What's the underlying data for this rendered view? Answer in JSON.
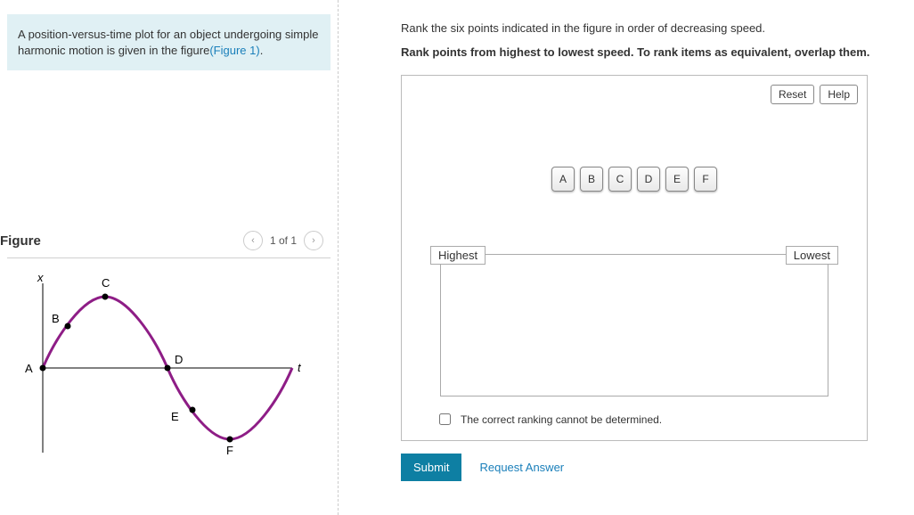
{
  "left": {
    "prompt_text_1": "A position-versus-time plot for an object undergoing simple harmonic motion is given in the figure",
    "prompt_link": "(Figure 1)",
    "prompt_text_2": ".",
    "figure_heading": "Figure",
    "pager_label": "1 of 1",
    "axes": {
      "x": "t",
      "y": "x"
    },
    "points": [
      "A",
      "B",
      "C",
      "D",
      "E",
      "F"
    ]
  },
  "right": {
    "question_line1": "Rank the six points indicated in the figure in order of decreasing speed.",
    "question_line2": "Rank points from highest to lowest speed. To rank items as equivalent, overlap them.",
    "reset_label": "Reset",
    "help_label": "Help",
    "tiles": [
      "A",
      "B",
      "C",
      "D",
      "E",
      "F"
    ],
    "dropzone": {
      "left_label": "Highest",
      "right_label": "Lowest"
    },
    "cannot_determine_label": "The correct ranking cannot be determined.",
    "submit_label": "Submit",
    "request_label": "Request Answer"
  },
  "chart_data": {
    "type": "line",
    "title": "",
    "xlabel": "t",
    "ylabel": "x",
    "xlim": [
      0,
      10
    ],
    "ylim": [
      -1,
      1
    ],
    "series": [
      {
        "name": "position",
        "x": [
          0,
          0.5,
          1,
          1.5,
          2,
          2.5,
          3,
          3.5,
          4,
          4.5,
          5,
          5.5,
          6,
          6.5,
          7,
          7.5,
          8,
          8.5,
          9,
          9.5,
          10
        ],
        "y": [
          0,
          0.31,
          0.59,
          0.81,
          0.95,
          1.0,
          0.95,
          0.81,
          0.59,
          0.31,
          0,
          -0.31,
          -0.59,
          -0.81,
          -0.95,
          -1.0,
          -0.95,
          -0.81,
          -0.59,
          -0.31,
          0
        ]
      }
    ],
    "annotations": [
      {
        "label": "A",
        "x": 0,
        "y": 0
      },
      {
        "label": "B",
        "x": 1,
        "y": 0.59
      },
      {
        "label": "C",
        "x": 2.5,
        "y": 1.0
      },
      {
        "label": "D",
        "x": 5,
        "y": 0
      },
      {
        "label": "E",
        "x": 6,
        "y": -0.59
      },
      {
        "label": "F",
        "x": 7.5,
        "y": -1.0
      }
    ]
  }
}
